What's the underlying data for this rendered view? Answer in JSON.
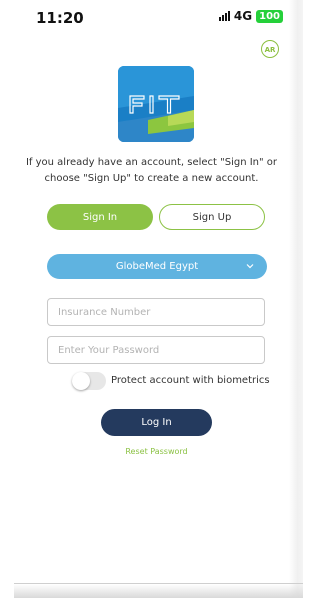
{
  "status_bar": {
    "time": "11:20",
    "network": "4G",
    "battery": "100"
  },
  "language_toggle": "AR",
  "logo": {
    "text": "FIT"
  },
  "intro_text": "If you already have an account, select \"Sign In\" or choose \"Sign Up\" to create a new account.",
  "auth_tabs": {
    "sign_in": "Sign In",
    "sign_up": "Sign Up",
    "selected": "Sign In"
  },
  "provider_select": {
    "value": "GlobeMed Egypt"
  },
  "fields": {
    "insurance_placeholder": "Insurance Number",
    "password_placeholder": "Enter Your Password"
  },
  "biometrics": {
    "label": "Protect account with biometrics",
    "enabled": false
  },
  "login_label": "Log In",
  "reset_label": "Reset Password",
  "colors": {
    "green": "#8cc245",
    "blue": "#5fb3e0",
    "navy": "#243a5e"
  }
}
